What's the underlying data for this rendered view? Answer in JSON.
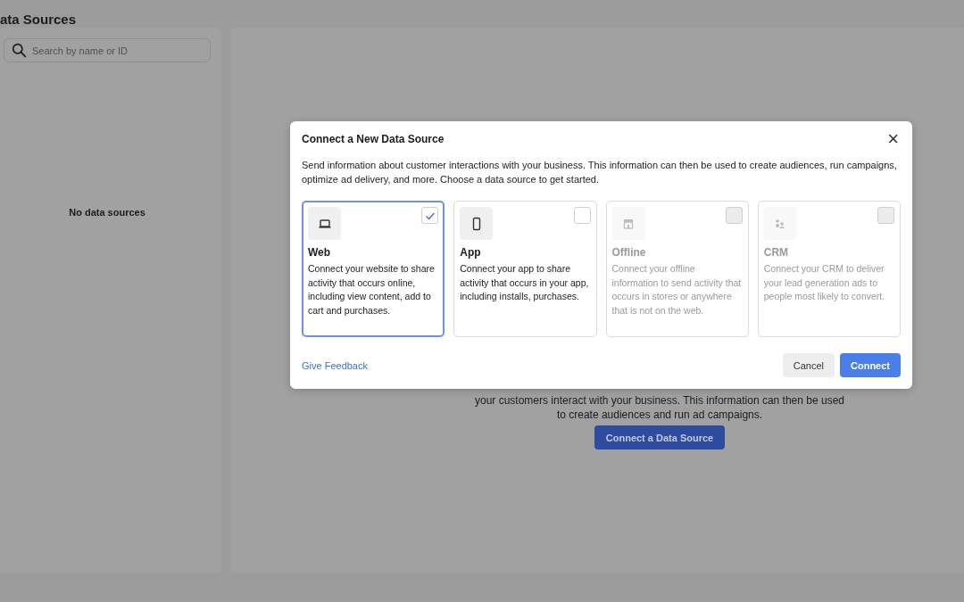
{
  "page": {
    "title": "ata Sources"
  },
  "sidebar": {
    "search": {
      "placeholder": "Search by name or ID"
    },
    "empty_text": "No data sources"
  },
  "main": {
    "description_lines": [
      "your customers interact with your business. This information can then be used",
      "to create audiences and run ad campaigns."
    ],
    "button": "Connect a Data Source"
  },
  "dialog": {
    "title": "Connect a New Data Source",
    "close": "×",
    "intro": "Send information about customer interactions with your business. This information can then be used to create audiences, run campaigns, optimize ad delivery, and more. Choose a data source to get started.",
    "options": [
      {
        "kind": "web",
        "title": "Web",
        "description": "Connect your website to share activity that occurs online, including view content, add to cart and purchases.",
        "selected": true,
        "disabled": false
      },
      {
        "kind": "app",
        "title": "App",
        "description": "Connect your app to share activity that occurs in your app, including installs, purchases.",
        "selected": false,
        "disabled": false
      },
      {
        "kind": "offline",
        "title": "Offline",
        "description": "Connect your offline information to send activity that occurs in stores or anywhere that is not on the web.",
        "selected": false,
        "disabled": true
      },
      {
        "kind": "crm",
        "title": "CRM",
        "description": "Connect your CRM to deliver your lead generation ads to people most likely to convert.",
        "selected": false,
        "disabled": true
      }
    ],
    "feedback_link": "Give Feedback",
    "cancel": "Cancel",
    "confirm": "Connect"
  }
}
